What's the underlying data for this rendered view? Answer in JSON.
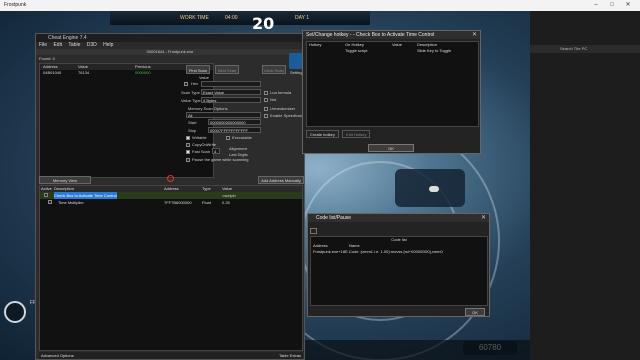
{
  "host": {
    "title": "Frostpunk",
    "min": "–",
    "max": "□",
    "close": "✕"
  },
  "hud": {
    "time": "20",
    "left": "WORK TIME",
    "mid": "04:00",
    "right": "DAY 1",
    "counter": "60780"
  },
  "left_ui": {
    "label": "FROST",
    "sub": "..."
  },
  "rightapp": {
    "search": "Search The PC"
  },
  "ce": {
    "title": "Cheat Engine 7.4",
    "menu": [
      "File",
      "Edit",
      "Table",
      "D3D",
      "Help"
    ],
    "process": "00001644 - Frostpunk.exe",
    "found": "Found: 0",
    "results_cols": [
      "Address",
      "Value",
      "Previous"
    ],
    "results_rows": [
      {
        "address": "04B01040",
        "value": "76134",
        "previous": "0000000"
      }
    ],
    "first_scan": "First Scan",
    "next_scan": "Next Scan",
    "undo_scan": "Undo Scan",
    "settings": "Settings",
    "value_label": "Value",
    "hex": "Hex",
    "scan_type_label": "Scan Type",
    "scan_type": "Exact Value",
    "value_type_label": "Value Type",
    "value_type": "4 Bytes",
    "lua_formula": "Lua formula",
    "not": "Not",
    "mem_options": "Memory Scan Options",
    "all": "All",
    "start_label": "Start",
    "start": "0000000000000000",
    "stop_label": "Stop",
    "stop": "00007FFFFFFFFFFF",
    "unrandomizer": "Unrandomizer",
    "speedhack": "Enable Speedhack",
    "writable": "Writable",
    "executable": "Executable",
    "copyonwrite": "CopyOnWrite",
    "fast_scan": "Fast Scan",
    "fast_val": "4",
    "alignment": "Alignment",
    "last_digits": "Last Digits",
    "pause": "Pause the game while scanning",
    "memory_view": "Memory View",
    "add_address": "Add Address Manually",
    "table_cols": [
      "Active",
      "Description",
      "Address",
      "Type",
      "Value"
    ],
    "table_rows": [
      {
        "description": "Check Box to Activate Time Control",
        "address": "",
        "type": "",
        "value": "<script>"
      },
      {
        "description": "Time Multiplier",
        "address": "7FF7B6000000",
        "type": "Float",
        "value": "0.25"
      }
    ],
    "advanced": "Advanced Options",
    "table_extras": "Table Extras"
  },
  "hotkey": {
    "title": "Set/Change hotkey - - Check Box to Activate Time Control",
    "close": "✕",
    "cols": [
      "Hotkey",
      "On Hotkey",
      "Value",
      "Description"
    ],
    "rows": [
      {
        "hotkey": "",
        "on_hotkey": "Toggle script",
        "value": "",
        "description": "Slide Key to Toggle"
      }
    ],
    "tabs": [
      "Create hotkey",
      "Edit Hotkey"
    ],
    "ok": "OK"
  },
  "codelist": {
    "title": "Code list/Pause",
    "close": "✕",
    "caption": "Code list",
    "cols": [
      "Address",
      "Name"
    ],
    "rows": [
      {
        "address": "Frostpunk.exe+18E...",
        "name": "Code :(zmm1 i.e. 1.00):movss [rsi+000000D0],xmm0"
      }
    ],
    "ok": "OK"
  },
  "colors": {
    "accent": "#2b7bd6",
    "selected_row": "#2a3b1c"
  }
}
